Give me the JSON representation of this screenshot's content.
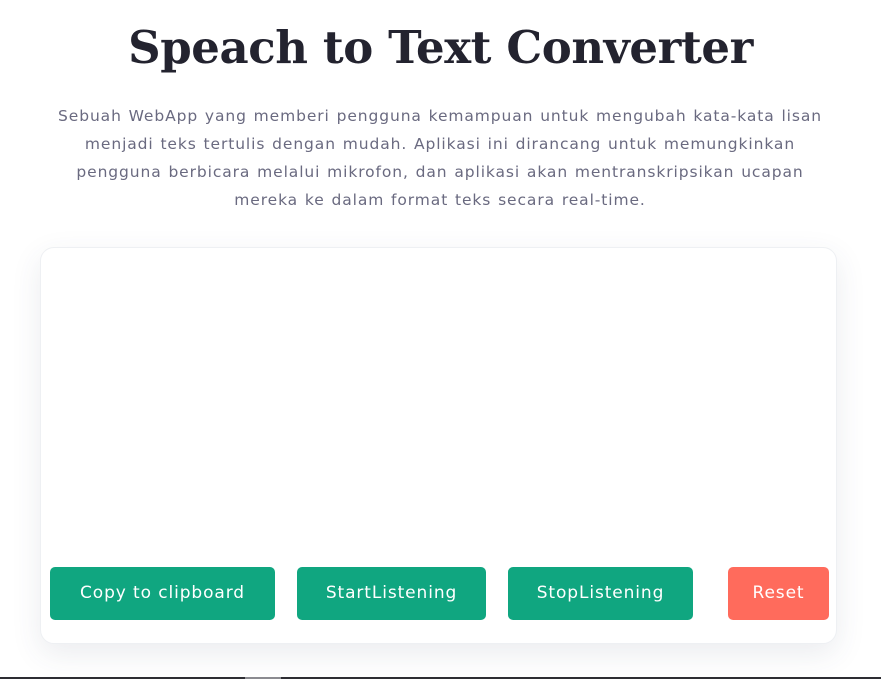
{
  "header": {
    "title": "Speach to Text Converter",
    "description": "Sebuah WebApp yang memberi pengguna kemampuan untuk mengubah kata-kata lisan menjadi teks tertulis dengan mudah. Aplikasi ini dirancang untuk memungkinkan pengguna berbicara melalui mikrofon, dan aplikasi akan mentranskripsikan ucapan mereka ke dalam format teks secara real-time."
  },
  "transcript": {
    "text": ""
  },
  "controls": {
    "copy_label": "Copy to clipboard",
    "start_label": "StartListening",
    "stop_label": "StopListening",
    "reset_label": "Reset"
  },
  "colors": {
    "primary": "#10a680",
    "danger": "#ff6b5c",
    "title": "#23232f",
    "text_muted": "#6a6a80"
  }
}
